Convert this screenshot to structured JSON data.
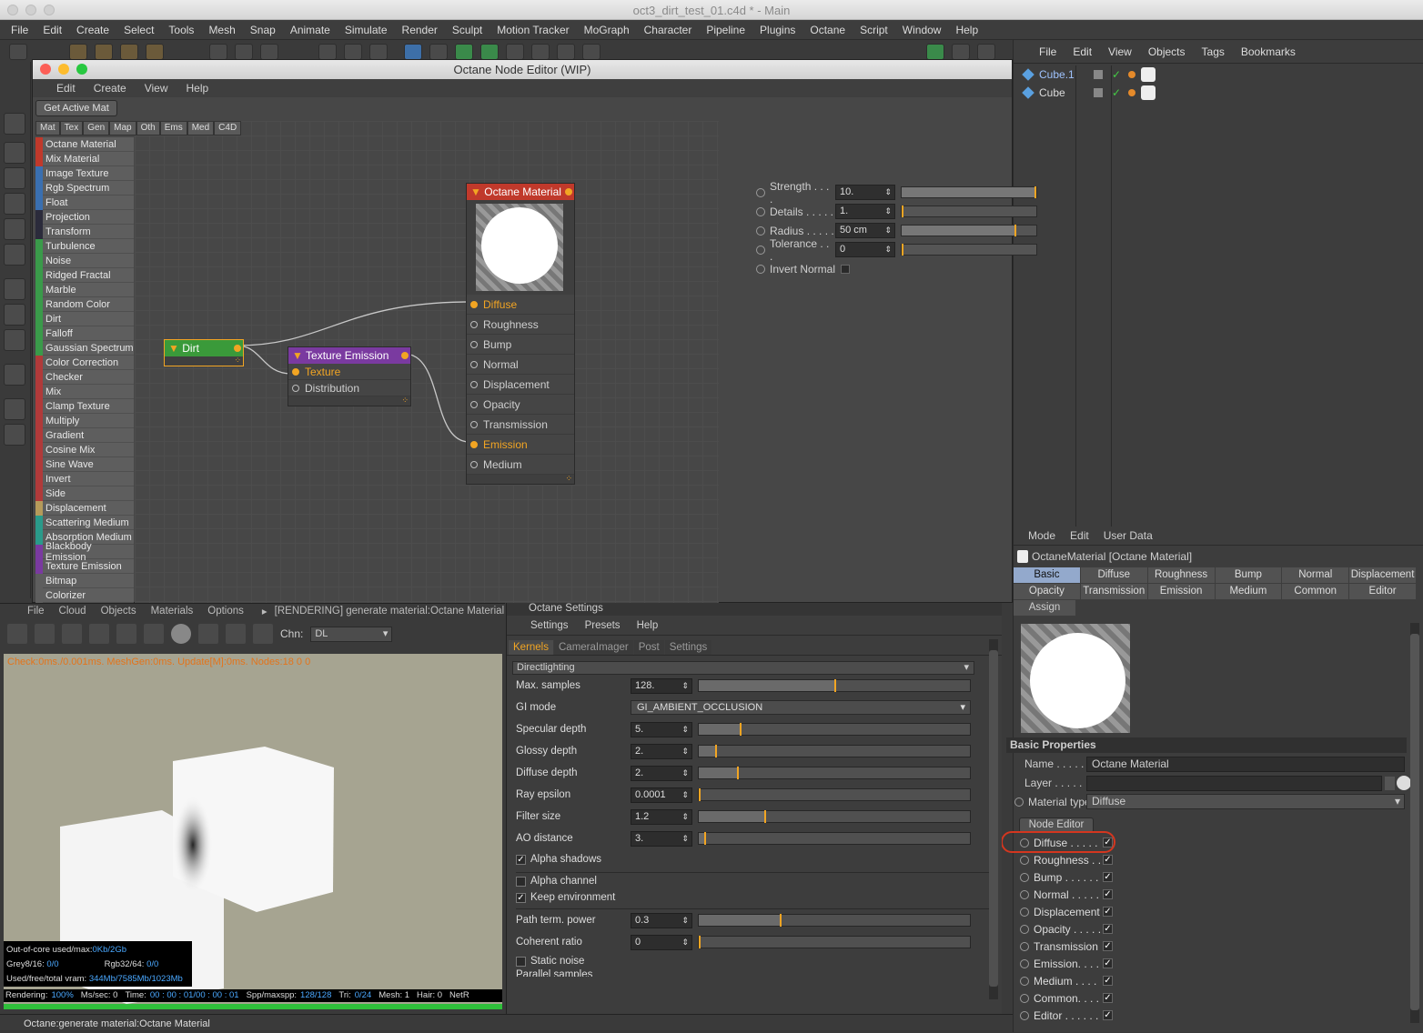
{
  "window": {
    "title": "oct3_dirt_test_01.c4d * - Main"
  },
  "menu": [
    "File",
    "Edit",
    "Create",
    "Select",
    "Tools",
    "Mesh",
    "Snap",
    "Animate",
    "Simulate",
    "Render",
    "Sculpt",
    "Motion Tracker",
    "MoGraph",
    "Character",
    "Pipeline",
    "Plugins",
    "Octane",
    "Script",
    "Window",
    "Help"
  ],
  "node_editor": {
    "title": "Octane Node Editor (WIP)",
    "menu": [
      "Edit",
      "Create",
      "View",
      "Help"
    ],
    "get_active": "Get Active Mat",
    "cat_tabs": [
      "Mat",
      "Tex",
      "Gen",
      "Map",
      "Oth",
      "Ems",
      "Med",
      "C4D"
    ],
    "node_list": [
      {
        "label": "Octane Material",
        "color": "#c0392b"
      },
      {
        "label": "Mix Material",
        "color": "#c0392b"
      },
      {
        "label": "Image Texture",
        "color": "#3a6fb0"
      },
      {
        "label": "Rgb Spectrum",
        "color": "#3a6fb0"
      },
      {
        "label": "Float",
        "color": "#3a6fb0"
      },
      {
        "label": "Projection",
        "color": "#2b2b3b"
      },
      {
        "label": "Transform",
        "color": "#2b2b3b"
      },
      {
        "label": "Turbulence",
        "color": "#3a9a4a"
      },
      {
        "label": "Noise",
        "color": "#3a9a4a"
      },
      {
        "label": "Ridged Fractal",
        "color": "#3a9a4a"
      },
      {
        "label": "Marble",
        "color": "#3a9a4a"
      },
      {
        "label": "Random Color",
        "color": "#3a9a4a"
      },
      {
        "label": "Dirt",
        "color": "#3a9a4a"
      },
      {
        "label": "Falloff",
        "color": "#3a9a4a"
      },
      {
        "label": "Gaussian Spectrum",
        "color": "#3a9a4a"
      },
      {
        "label": "Color Correction",
        "color": "#b03a3a"
      },
      {
        "label": "Checker",
        "color": "#b03a3a"
      },
      {
        "label": "Mix",
        "color": "#b03a3a"
      },
      {
        "label": "Clamp Texture",
        "color": "#b03a3a"
      },
      {
        "label": "Multiply",
        "color": "#b03a3a"
      },
      {
        "label": "Gradient",
        "color": "#b03a3a"
      },
      {
        "label": "Cosine Mix",
        "color": "#b03a3a"
      },
      {
        "label": "Sine Wave",
        "color": "#b03a3a"
      },
      {
        "label": "Invert",
        "color": "#b03a3a"
      },
      {
        "label": "Side",
        "color": "#b03a3a"
      },
      {
        "label": "Displacement",
        "color": "#b59a5a"
      },
      {
        "label": "Scattering Medium",
        "color": "#2a9a8a"
      },
      {
        "label": "Absorption Medium",
        "color": "#2a9a8a"
      },
      {
        "label": "Blackbody Emission",
        "color": "#7a3aa0"
      },
      {
        "label": "Texture Emission",
        "color": "#7a3aa0"
      },
      {
        "label": "Bitmap",
        "color": "#5e5e5e"
      },
      {
        "label": "Colorizer",
        "color": "#5e5e5e"
      }
    ],
    "dirt_node": "Dirt",
    "emission_node": {
      "title": "Texture Emission",
      "ports": [
        "Texture",
        "Distribution"
      ]
    },
    "material_node": {
      "title": "Octane Material",
      "ports": [
        "Diffuse",
        "Roughness",
        "Bump",
        "Normal",
        "Displacement",
        "Opacity",
        "Transmission",
        "Emission",
        "Medium"
      ]
    },
    "params": [
      {
        "label": "Strength . . . .",
        "value": "10.",
        "fill": 1.0
      },
      {
        "label": "Details . . . . .",
        "value": "1.",
        "fill": 0.0
      },
      {
        "label": "Radius . . . . .",
        "value": "50 cm",
        "fill": 0.85
      },
      {
        "label": "Tolerance . . .",
        "value": "0",
        "fill": 0.0
      }
    ],
    "invert_normal": "Invert Normal"
  },
  "objects": {
    "menu": [
      "File",
      "Edit",
      "View",
      "Objects",
      "Tags",
      "Bookmarks"
    ],
    "items": [
      "Cube.1",
      "Cube"
    ]
  },
  "attributes": {
    "menu": [
      "Mode",
      "Edit",
      "User Data"
    ],
    "header": "OctaneMaterial [Octane Material]",
    "tabs": [
      "Basic",
      "Diffuse",
      "Roughness",
      "Bump",
      "Normal",
      "Displacement",
      "Opacity",
      "Transmission",
      "Emission",
      "Medium",
      "Common",
      "Editor",
      "Assign"
    ],
    "section": "Basic Properties",
    "name_label": "Name . . . . .",
    "name_value": "Octane Material",
    "layer_label": "Layer . . . . .",
    "mattype_label": "Material type",
    "mattype_value": "Diffuse",
    "node_editor_btn": "Node Editor",
    "checks": [
      "Diffuse . . . . .",
      "Roughness . .",
      "Bump . . . . . .",
      "Normal . . . . .",
      "Displacement",
      "Opacity . . . . .",
      "Transmission",
      "Emission. . . .",
      "Medium . . . .",
      "Common. . . .",
      "Editor . . . . . ."
    ]
  },
  "render": {
    "menu": [
      "File",
      "Cloud",
      "Objects",
      "Materials",
      "Options"
    ],
    "status": "[RENDERING] generate material:Octane Material",
    "chn_label": "Chn:",
    "chn_value": "DL",
    "check": "Check:0ms./0.001ms. MeshGen:0ms. Update[M]:0ms. Nodes:18  0 0",
    "ooc": "Out-of-core used/max:",
    "ooc_v": "0Kb/2Gb",
    "grey": "Grey8/16:",
    "grey_v": "0/0",
    "rgb": "Rgb32/64:",
    "rgb_v": "0/0",
    "vram": "Used/free/total vram:",
    "vram_v": "344Mb/7585Mb/1023Mb",
    "bottom": [
      "Rendering:",
      "100%",
      "Ms/sec: 0",
      "Time:",
      "00 : 00 : 01/00 : 00 : 01",
      "Spp/maxspp:",
      "128/128",
      "Tri:",
      "0/24",
      "Mesh: 1",
      "Hair: 0",
      "NetR"
    ],
    "progress": 1.0
  },
  "settings": {
    "title": "Octane Settings",
    "menu": [
      "Settings",
      "Presets",
      "Help"
    ],
    "tabs": [
      "Kernels",
      "CameraImager",
      "Post",
      "Settings"
    ],
    "kernel": "Directlighting",
    "rows": [
      {
        "label": "Max. samples",
        "value": "128.",
        "fill": 0.5
      },
      {
        "label": "GI mode",
        "value": "GI_AMBIENT_OCCLUSION",
        "fill": null
      },
      {
        "label": "Specular depth",
        "value": "5.",
        "fill": 0.15
      },
      {
        "label": "Glossy depth",
        "value": "2.",
        "fill": 0.06
      },
      {
        "label": "Diffuse depth",
        "value": "2.",
        "fill": 0.14
      },
      {
        "label": "Ray epsilon",
        "value": "0.0001",
        "fill": 0.0
      },
      {
        "label": "Filter size",
        "value": "1.2",
        "fill": 0.24
      },
      {
        "label": "AO distance",
        "value": "3.",
        "fill": 0.02
      }
    ],
    "alpha_shadows": "Alpha shadows",
    "alpha_channel": "Alpha channel",
    "keep_env": "Keep environment",
    "rows2": [
      {
        "label": "Path term. power",
        "value": "0.3",
        "fill": 0.3
      },
      {
        "label": "Coherent ratio",
        "value": "0",
        "fill": 0.0
      }
    ],
    "static_noise": "Static noise",
    "parallel": "Parallel samples"
  },
  "statusbar": "Octane:generate material:Octane Material"
}
